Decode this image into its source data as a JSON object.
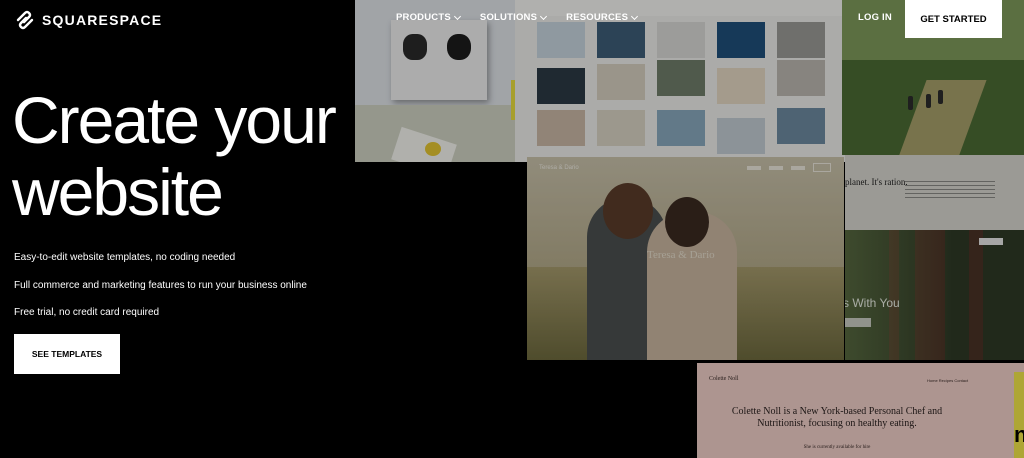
{
  "header": {
    "logo_text": "SQUARESPACE",
    "nav": [
      {
        "label": "PRODUCTS"
      },
      {
        "label": "SOLUTIONS"
      },
      {
        "label": "RESOURCES"
      }
    ],
    "login_label": "LOG IN",
    "get_started_label": "GET STARTED"
  },
  "hero": {
    "title_line1": "Create your",
    "title_line2": "website",
    "features": [
      "Easy-to-edit website templates, no coding needed",
      "Full commerce and marketing features to run your business online",
      "Free trial, no credit card required"
    ],
    "cta_label": "SEE TEMPLATES"
  },
  "collage": {
    "couple_names": "Teresa & Dario",
    "couple_title": "Teresa & Dario",
    "redwood_heading": "s With You",
    "textpanel_text": "planet. It's ration.",
    "chef_brand": "Colette Noll",
    "chef_nav": "Home  Recipes  Contact",
    "chef_text": "Colette Noll is a New York-based Personal Chef and Nutritionist, focusing on healthy eating.",
    "chef_small": "She is currently available for hire",
    "yellow_glyph": "n"
  },
  "colors": {
    "background": "#000000",
    "button_bg": "#ffffff",
    "button_text": "#000000"
  }
}
